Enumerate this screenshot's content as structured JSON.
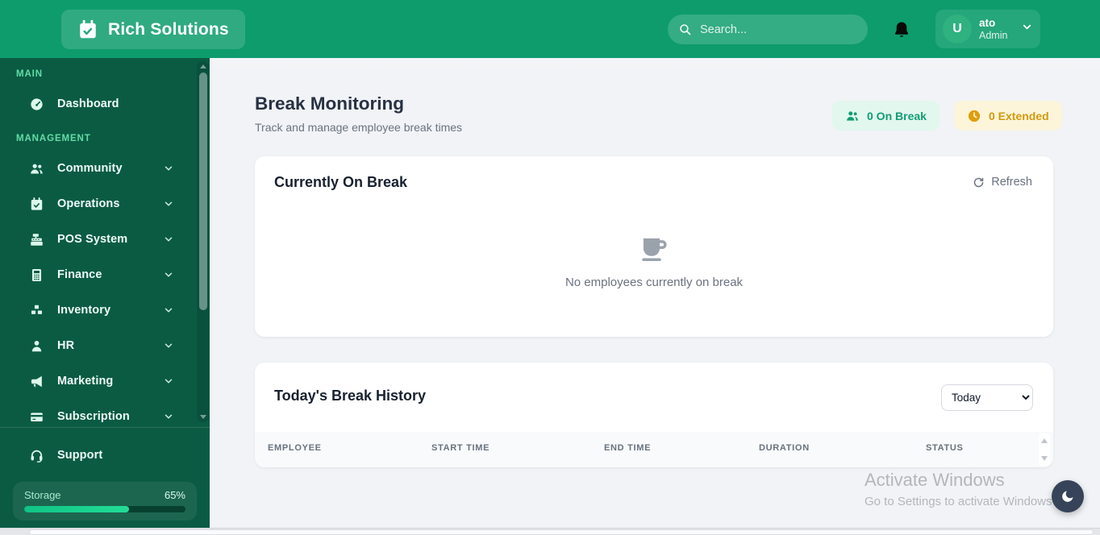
{
  "header": {
    "brand": "Rich Solutions",
    "search_placeholder": "Search...",
    "user": {
      "initial": "U",
      "name": "ato",
      "role": "Admin"
    }
  },
  "sidebar": {
    "sections": [
      {
        "label": "MAIN",
        "items": [
          {
            "label": "Dashboard"
          }
        ]
      },
      {
        "label": "MANAGEMENT",
        "items": [
          {
            "label": "Community"
          },
          {
            "label": "Operations"
          },
          {
            "label": "POS System"
          },
          {
            "label": "Finance"
          },
          {
            "label": "Inventory"
          },
          {
            "label": "HR"
          },
          {
            "label": "Marketing"
          },
          {
            "label": "Subscription"
          }
        ]
      }
    ],
    "support_label": "Support",
    "storage": {
      "label": "Storage",
      "percent": "65%"
    }
  },
  "page": {
    "title": "Break Monitoring",
    "subtitle": "Track and manage employee break times",
    "on_break_badge": "0 On Break",
    "extended_badge": "0 Extended"
  },
  "current_card": {
    "title": "Currently On Break",
    "refresh_label": "Refresh",
    "empty_message": "No employees currently on break"
  },
  "history_card": {
    "title": "Today's Break History",
    "filter_value": "Today",
    "columns": [
      "EMPLOYEE",
      "START TIME",
      "END TIME",
      "DURATION",
      "STATUS"
    ],
    "rows": []
  },
  "watermark": {
    "line1": "Activate Windows",
    "line2": "Go to Settings to activate Windows"
  },
  "colors": {
    "header_green": "#0e9c6d",
    "sidebar_green": "#0b5b43",
    "accent_green": "#10b981",
    "on_break_text": "#119d72",
    "extended_text": "#d19a0e",
    "fab_navy": "#364358"
  }
}
